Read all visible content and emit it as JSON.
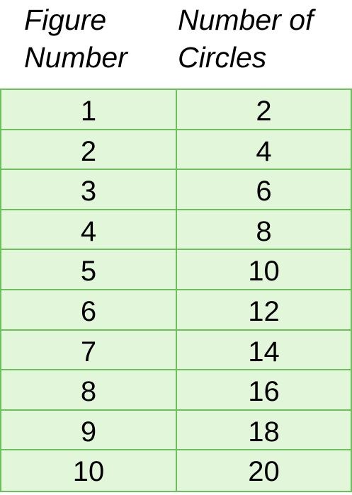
{
  "chart_data": {
    "type": "table",
    "columns": [
      [
        "Figure",
        "Number"
      ],
      [
        "Number of",
        "Circles"
      ]
    ],
    "rows": [
      [
        "1",
        "2"
      ],
      [
        "2",
        "4"
      ],
      [
        "3",
        "6"
      ],
      [
        "4",
        "8"
      ],
      [
        "5",
        "10"
      ],
      [
        "6",
        "12"
      ],
      [
        "7",
        "14"
      ],
      [
        "8",
        "16"
      ],
      [
        "9",
        "18"
      ],
      [
        "10",
        "20"
      ]
    ],
    "colors": {
      "cell_fill": "#e2f7d9",
      "grid": "#6cc05c"
    }
  }
}
